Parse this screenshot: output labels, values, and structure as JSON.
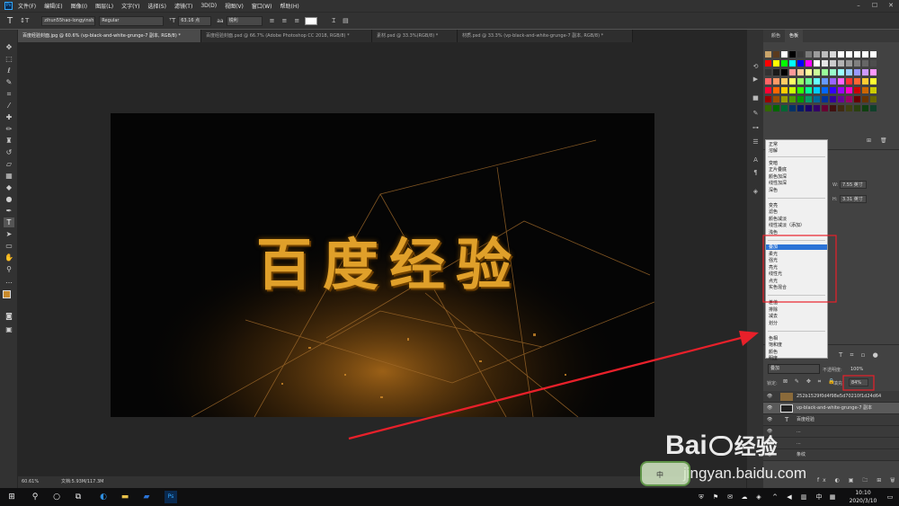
{
  "app": {
    "logo": "Ps"
  },
  "menu": [
    "文件(F)",
    "编辑(E)",
    "图像(I)",
    "图层(L)",
    "文字(Y)",
    "选择(S)",
    "滤镜(T)",
    "3D(D)",
    "视图(V)",
    "窗口(W)",
    "帮助(H)"
  ],
  "options": {
    "font_family": "zihun55hao-longyinsh...",
    "font_style": "Regular",
    "font_size": "63.16 点",
    "antialias": "锐利"
  },
  "tabs": [
    "百度经验封面.jpg @ 60.6% (vp-black-and-white-grunge-7 副本, RGB/8) *",
    "百度经验封面.psd @ 66.7% (Adobe Photoshop CC 2018, RGB/8) *",
    "素材.psd @ 33.3%(RGB/8) *",
    "材质.psd @ 33.3% (vp-black-and-white-grunge-7 副本, RGB/8) *"
  ],
  "canvas": {
    "headline": "百度经验"
  },
  "status": {
    "zoom": "60.61%",
    "doc": "文档:5.93M/117.3M"
  },
  "panel": {
    "tabs": [
      "颜色",
      "色板"
    ],
    "props": {
      "w_label": "W:",
      "w_value": "7.55 英寸",
      "h_label": "H:",
      "h_value": "3.31 英寸"
    }
  },
  "swatch_colors": [
    [
      "#c9a46a",
      "#5a3a1e",
      "#ffffff",
      "#000000",
      "#3a3a3a",
      "#7a7a7a",
      "#9c9c9c",
      "#bdbdbd",
      "#d9d9d9",
      "#ffffff",
      "#ffffff",
      "#ffffff",
      "#ffffff",
      "#ffffff"
    ],
    [
      "#ff0000",
      "#ffff00",
      "#00ff00",
      "#00ffff",
      "#0000ff",
      "#ff00ff",
      "#ffffff",
      "#e6e6e6",
      "#cccccc",
      "#b3b3b3",
      "#999999",
      "#808080",
      "#666666",
      "#4d4d4d"
    ],
    [
      "#333333",
      "#1a1a1a",
      "#000000",
      "#ff9999",
      "#ffcc99",
      "#ffff99",
      "#ccff99",
      "#99ff99",
      "#99ffcc",
      "#99ffff",
      "#99ccff",
      "#9999ff",
      "#cc99ff",
      "#ff99ff"
    ],
    [
      "#ff6666",
      "#ff9966",
      "#ffcc66",
      "#ffff66",
      "#99ff66",
      "#66ff99",
      "#66ffff",
      "#6699ff",
      "#9966ff",
      "#ff66ff",
      "#ff3333",
      "#ff6633",
      "#ffcc33",
      "#ffff33"
    ],
    [
      "#ff0033",
      "#ff6600",
      "#ffcc00",
      "#ccff00",
      "#33ff00",
      "#00ff99",
      "#00ccff",
      "#0066ff",
      "#3300ff",
      "#9900ff",
      "#ff00cc",
      "#cc0000",
      "#cc6600",
      "#cccc00"
    ],
    [
      "#990000",
      "#994c00",
      "#999900",
      "#4c9900",
      "#009900",
      "#009966",
      "#006699",
      "#003399",
      "#330099",
      "#660099",
      "#990066",
      "#660000",
      "#663300",
      "#666600"
    ],
    [
      "#336600",
      "#006600",
      "#006633",
      "#003366",
      "#001a66",
      "#1a0066",
      "#330066",
      "#660033",
      "#401010",
      "#402a10",
      "#404010",
      "#2a4010",
      "#104010",
      "#10402a"
    ]
  ],
  "blend_modes": {
    "group1": [
      "正常",
      "溶解"
    ],
    "group2": [
      "变暗",
      "正片叠底",
      "颜色加深",
      "线性加深",
      "深色"
    ],
    "group3": [
      "变亮",
      "滤色",
      "颜色减淡",
      "线性减淡（添加）",
      "浅色"
    ],
    "group4": [
      "叠加",
      "柔光",
      "强光",
      "亮光",
      "线性光",
      "点光",
      "实色混合"
    ],
    "group5": [
      "差值",
      "排除",
      "减去",
      "划分"
    ],
    "group6": [
      "色相",
      "饱和度",
      "颜色",
      "明度"
    ],
    "selected": "叠加"
  },
  "layers_panel": {
    "blend_value": "叠加",
    "opacity_label": "不透明度:",
    "opacity_value": "100%",
    "lock_label": "锁定:",
    "fill_label": "填充:",
    "fill_value": "84%",
    "layers": [
      {
        "name": "252b1529f0d4f98e5d70210f1d24d64"
      },
      {
        "name": "vp-black-and-white-grunge-7 副本"
      },
      {
        "name": "百度经验"
      },
      {
        "name": "..."
      },
      {
        "name": "..."
      },
      {
        "name": "条纹"
      }
    ]
  },
  "watermark": {
    "brand": "Bai",
    "du": "经验",
    "url": "jingyan.baidu.com",
    "badge": "中"
  },
  "taskbar": {
    "lang": "中",
    "time": "10:10",
    "date": "2020/3/10"
  },
  "colors": {
    "accent": "#2b73d6",
    "text_gold": "#e0a02a",
    "annotation_red": "#e8202a"
  }
}
